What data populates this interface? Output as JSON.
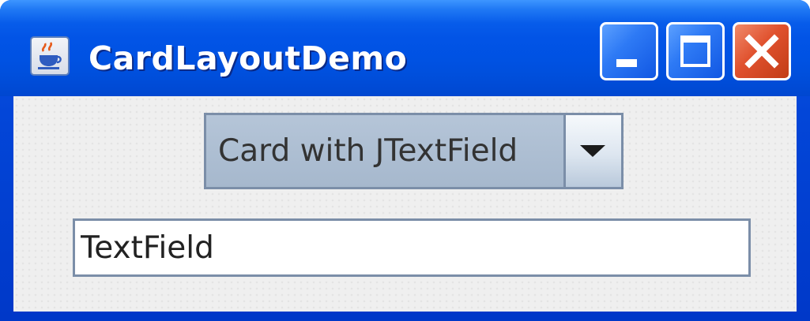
{
  "window": {
    "title": "CardLayoutDemo",
    "app_icon": "java-coffee-cup-icon",
    "controls": {
      "minimize_icon": "minimize-icon",
      "maximize_icon": "maximize-icon",
      "close_icon": "close-icon"
    },
    "colors": {
      "titlebar": "#0054e3",
      "close_button": "#e0512e",
      "content_background": "#efefef"
    }
  },
  "combo": {
    "selected": "Card with JTextField",
    "arrow_icon": "dropdown-arrow-icon"
  },
  "text_field": {
    "value": "TextField"
  }
}
